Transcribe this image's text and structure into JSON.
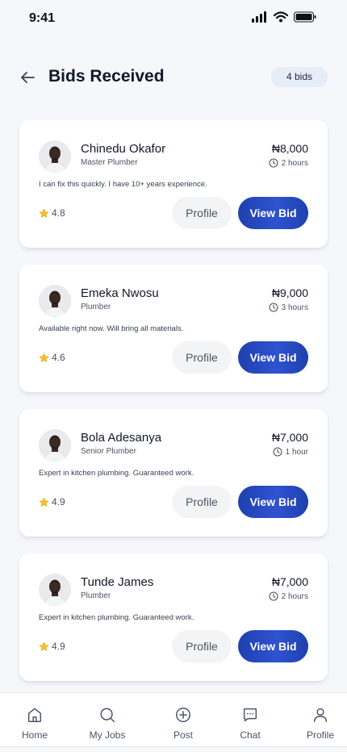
{
  "status": {
    "time": "9:41"
  },
  "header": {
    "title": "Bids Received",
    "count_badge": "4 bids"
  },
  "bids": [
    {
      "name": "Chinedu Okafor",
      "role": "Master Plumber",
      "price": "₦8,000",
      "time": "2 hours",
      "message": "I can fix this quickly. I have 10+ years experience.",
      "rating": "4.8",
      "profile_label": "Profile",
      "view_label": "View Bid"
    },
    {
      "name": "Emeka Nwosu",
      "role": "Plumber",
      "price": "₦9,000",
      "time": "3 hours",
      "message": "Available right now. Will bring all materials.",
      "rating": "4.6",
      "profile_label": "Profile",
      "view_label": "View Bid"
    },
    {
      "name": "Bola Adesanya",
      "role": "Senior Plumber",
      "price": "₦7,000",
      "time": "1 hour",
      "message": "Expert in kitchen plumbing. Guaranteed work.",
      "rating": "4.9",
      "profile_label": "Profile",
      "view_label": "View Bid"
    },
    {
      "name": "Tunde James",
      "role": "Plumber",
      "price": "₦7,000",
      "time": "2 hours",
      "message": "Expert in kitchen plumbing. Guaranteed work.",
      "rating": "4.9",
      "profile_label": "Profile",
      "view_label": "View Bid"
    }
  ],
  "nav": [
    {
      "label": "Home",
      "icon": "home-icon"
    },
    {
      "label": "My Jobs",
      "icon": "search-icon"
    },
    {
      "label": "Post",
      "icon": "plus-circle-icon"
    },
    {
      "label": "Chat",
      "icon": "chat-icon"
    },
    {
      "label": "Profile",
      "icon": "user-icon"
    }
  ],
  "colors": {
    "accent": "#1e40af",
    "badge_bg": "#e6ecf8",
    "background": "#f5f7fb"
  }
}
